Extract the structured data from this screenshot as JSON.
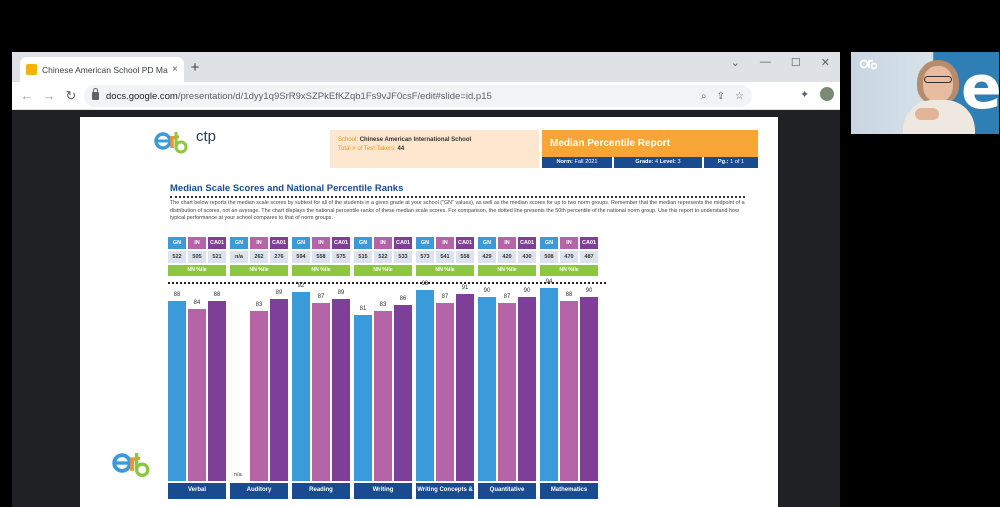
{
  "browser": {
    "tab_title": "Chinese American School PD Ma",
    "tab_close": "×",
    "new_tab": "+",
    "window_controls": [
      "⌄",
      "—",
      "☐",
      "✕"
    ],
    "url_host": "docs.google.com",
    "url_path": "/presentation/d/1dyy1q9SrR9xSZPkEfKZqb1Fs9vJF0csF/edit#slide=id.p15"
  },
  "report": {
    "school_label": "School:",
    "school_value": "Chinese American International School",
    "tests_label": "Total # of Test Takers:",
    "tests_value": "44",
    "title": "Median Percentile Report",
    "norm_label": "Norm:",
    "norm_value": "Fall 2021",
    "grade_label": "Grade:",
    "grade_value": "4",
    "level_label": "Level:",
    "level_value": "3",
    "page_label": "Pg.:",
    "page_value": "1 of 1",
    "logo_text": "ctp"
  },
  "section": {
    "title": "Median Scale Scores and National Percentile Ranks",
    "description": "The chart below reports the median scale scores by subtest for all of the students in a given grade at your school (\"GN\" values), as well as the median scores for up to two norm groups. Remember that the median represents the midpoint of a distribution of scores, not an average. The chart displays the national percentile ranks of these median scale scores. For comparison, the dotted line presents the 50th percentile of the national norm group. Use this report to understand how typical performance at your school compares to that of norm groups."
  },
  "colors": {
    "gn": "#3b9ad9",
    "in": "#b565a7",
    "ca01": "#7e3f98",
    "header_blue": "#1a4a8f",
    "nn_green": "#8dc63f",
    "orange": "#f7a535"
  },
  "chart_data": {
    "type": "bar",
    "categories": [
      "Verbal",
      "Auditory",
      "Reading",
      "Writing",
      "Writing Concepts &",
      "Quantitative",
      "Mathematics"
    ],
    "series": [
      {
        "name": "GN",
        "values": [
          88,
          null,
          92,
          81,
          93,
          90,
          94
        ]
      },
      {
        "name": "IN",
        "values": [
          84,
          83,
          87,
          83,
          87,
          87,
          88
        ]
      },
      {
        "name": "CA01",
        "values": [
          88,
          89,
          89,
          86,
          91,
          90,
          90
        ]
      }
    ],
    "scale_scores": [
      [
        "522",
        "505",
        "521"
      ],
      [
        "n/a",
        "262",
        "276"
      ],
      [
        "594",
        "558",
        "575"
      ],
      [
        "515",
        "522",
        "533"
      ],
      [
        "573",
        "541",
        "558"
      ],
      [
        "429",
        "420",
        "430"
      ],
      [
        "508",
        "470",
        "487"
      ]
    ],
    "header_labels": [
      "GN",
      "IN",
      "CA01"
    ],
    "nn_label": "NN %ile",
    "na_text": "n/a",
    "ylim": [
      0,
      100
    ],
    "reference_line": 50
  }
}
